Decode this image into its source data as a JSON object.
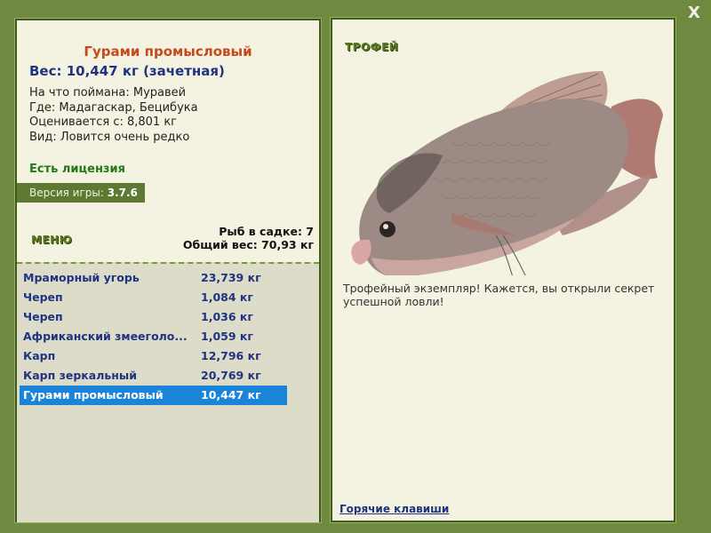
{
  "close_label": "X",
  "fish": {
    "title": "Гурами промысловый",
    "weight": "Вес: 10,447 кг (зачетная)",
    "info": [
      "На что поймана: Муравей",
      "Где: Мадагаскар, Бецибука",
      "Оценивается с: 8,801 кг",
      "Вид: Ловится очень редко"
    ]
  },
  "license": "Есть лицензия",
  "version": {
    "label": "Версия игры:",
    "value": "3.7.6"
  },
  "menu_label": "МЕНЮ",
  "keepnet": {
    "count": "Рыб в садке: 7",
    "total": "Общий вес: 70,93 кг"
  },
  "catches": [
    {
      "name": "Мраморный угорь",
      "weight": "23,739 кг"
    },
    {
      "name": "Череп",
      "weight": "1,084 кг"
    },
    {
      "name": "Череп",
      "weight": "1,036 кг"
    },
    {
      "name": "Африканский змееголо...",
      "weight": "1,059 кг"
    },
    {
      "name": "Карп",
      "weight": "12,796 кг"
    },
    {
      "name": "Карп зеркальный",
      "weight": "20,769 кг"
    },
    {
      "name": "Гурами промысловый",
      "weight": "10,447 кг"
    }
  ],
  "selected_index": 6,
  "trophy_label": "ТРОФЕЙ",
  "description": "Трофейный экземпляр! Кажется, вы открыли секрет успешной ловли!",
  "hotkeys_label": "Горячие клавиши"
}
